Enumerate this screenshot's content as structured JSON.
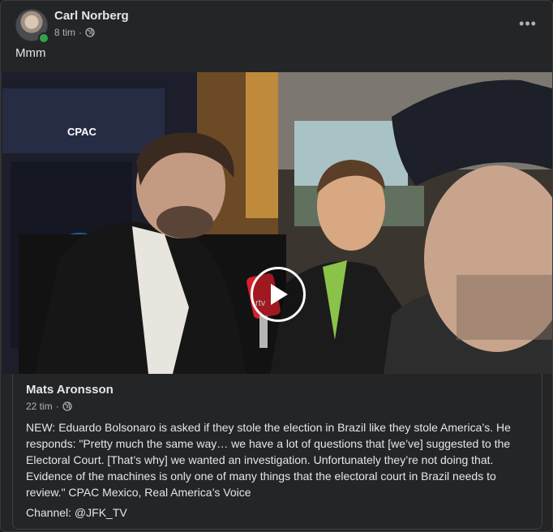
{
  "post": {
    "author": "Carl Norberg",
    "time": "8 tim",
    "separator": "·",
    "visibility_icon": "globe-icon",
    "text": "Mmm"
  },
  "video": {
    "play_icon": "play-icon",
    "sign_text": "CPAC",
    "mic_label": "rtv"
  },
  "shared": {
    "author": "Mats Aronsson",
    "time": "22 tim",
    "separator": "·",
    "body": "NEW: Eduardo Bolsonaro is asked if they stole the election in Brazil like they stole America’s. He responds: \"Pretty much the same way… we have a lot of questions that [we’ve] suggested to the Electoral Court. [That’s why] we wanted an investigation. Unfortunately they’re not doing that. Evidence of the machines is only one of many things that the electoral court in Brazil needs to review.\" CPAC Mexico, Real America’s Voice",
    "channel": "Channel: @JFK_TV"
  },
  "colors": {
    "card_bg": "#242526",
    "text_primary": "#e4e6eb",
    "text_secondary": "#b0b3b8",
    "online": "#31a24c"
  }
}
